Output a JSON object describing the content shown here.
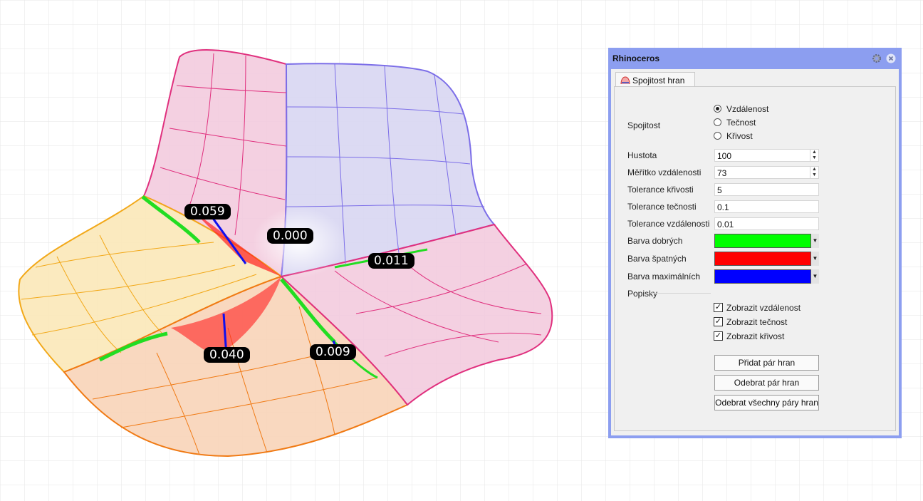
{
  "viewport": {
    "labels": [
      "0.059",
      "0.000",
      "0.011",
      "0.040",
      "0.009"
    ]
  },
  "panel": {
    "title": "Rhinoceros",
    "tab": "Spojitost hran",
    "continuity": {
      "label": "Spojitost",
      "options": [
        "Vzdálenost",
        "Tečnost",
        "Křivost"
      ],
      "selected": "Vzdálenost"
    },
    "density": {
      "label": "Hustota",
      "value": "100"
    },
    "distance_scale": {
      "label": "Měřítko vzdálenosti",
      "value": "73"
    },
    "curvature_tol": {
      "label": "Tolerance křivosti",
      "value": "5"
    },
    "tangency_tol": {
      "label": "Tolerance tečnosti",
      "value": "0.1"
    },
    "distance_tol": {
      "label": "Tolerance vzdálenosti",
      "value": "0.01"
    },
    "good_color": {
      "label": "Barva dobrých",
      "color": "#00ff00"
    },
    "bad_color": {
      "label": "Barva špatných",
      "color": "#ff0000"
    },
    "max_color": {
      "label": "Barva maximálních",
      "color": "#0000ff"
    },
    "captions": {
      "label": "Popisky",
      "show_distance": "Zobrazit vzdálenost",
      "show_tangency": "Zobrazit tečnost",
      "show_curvature": "Zobrazit křivost"
    },
    "buttons": {
      "add": "Přidat pár hran",
      "remove": "Odebrat pár hran",
      "remove_all": "Odebrat všechny páry hran"
    }
  }
}
